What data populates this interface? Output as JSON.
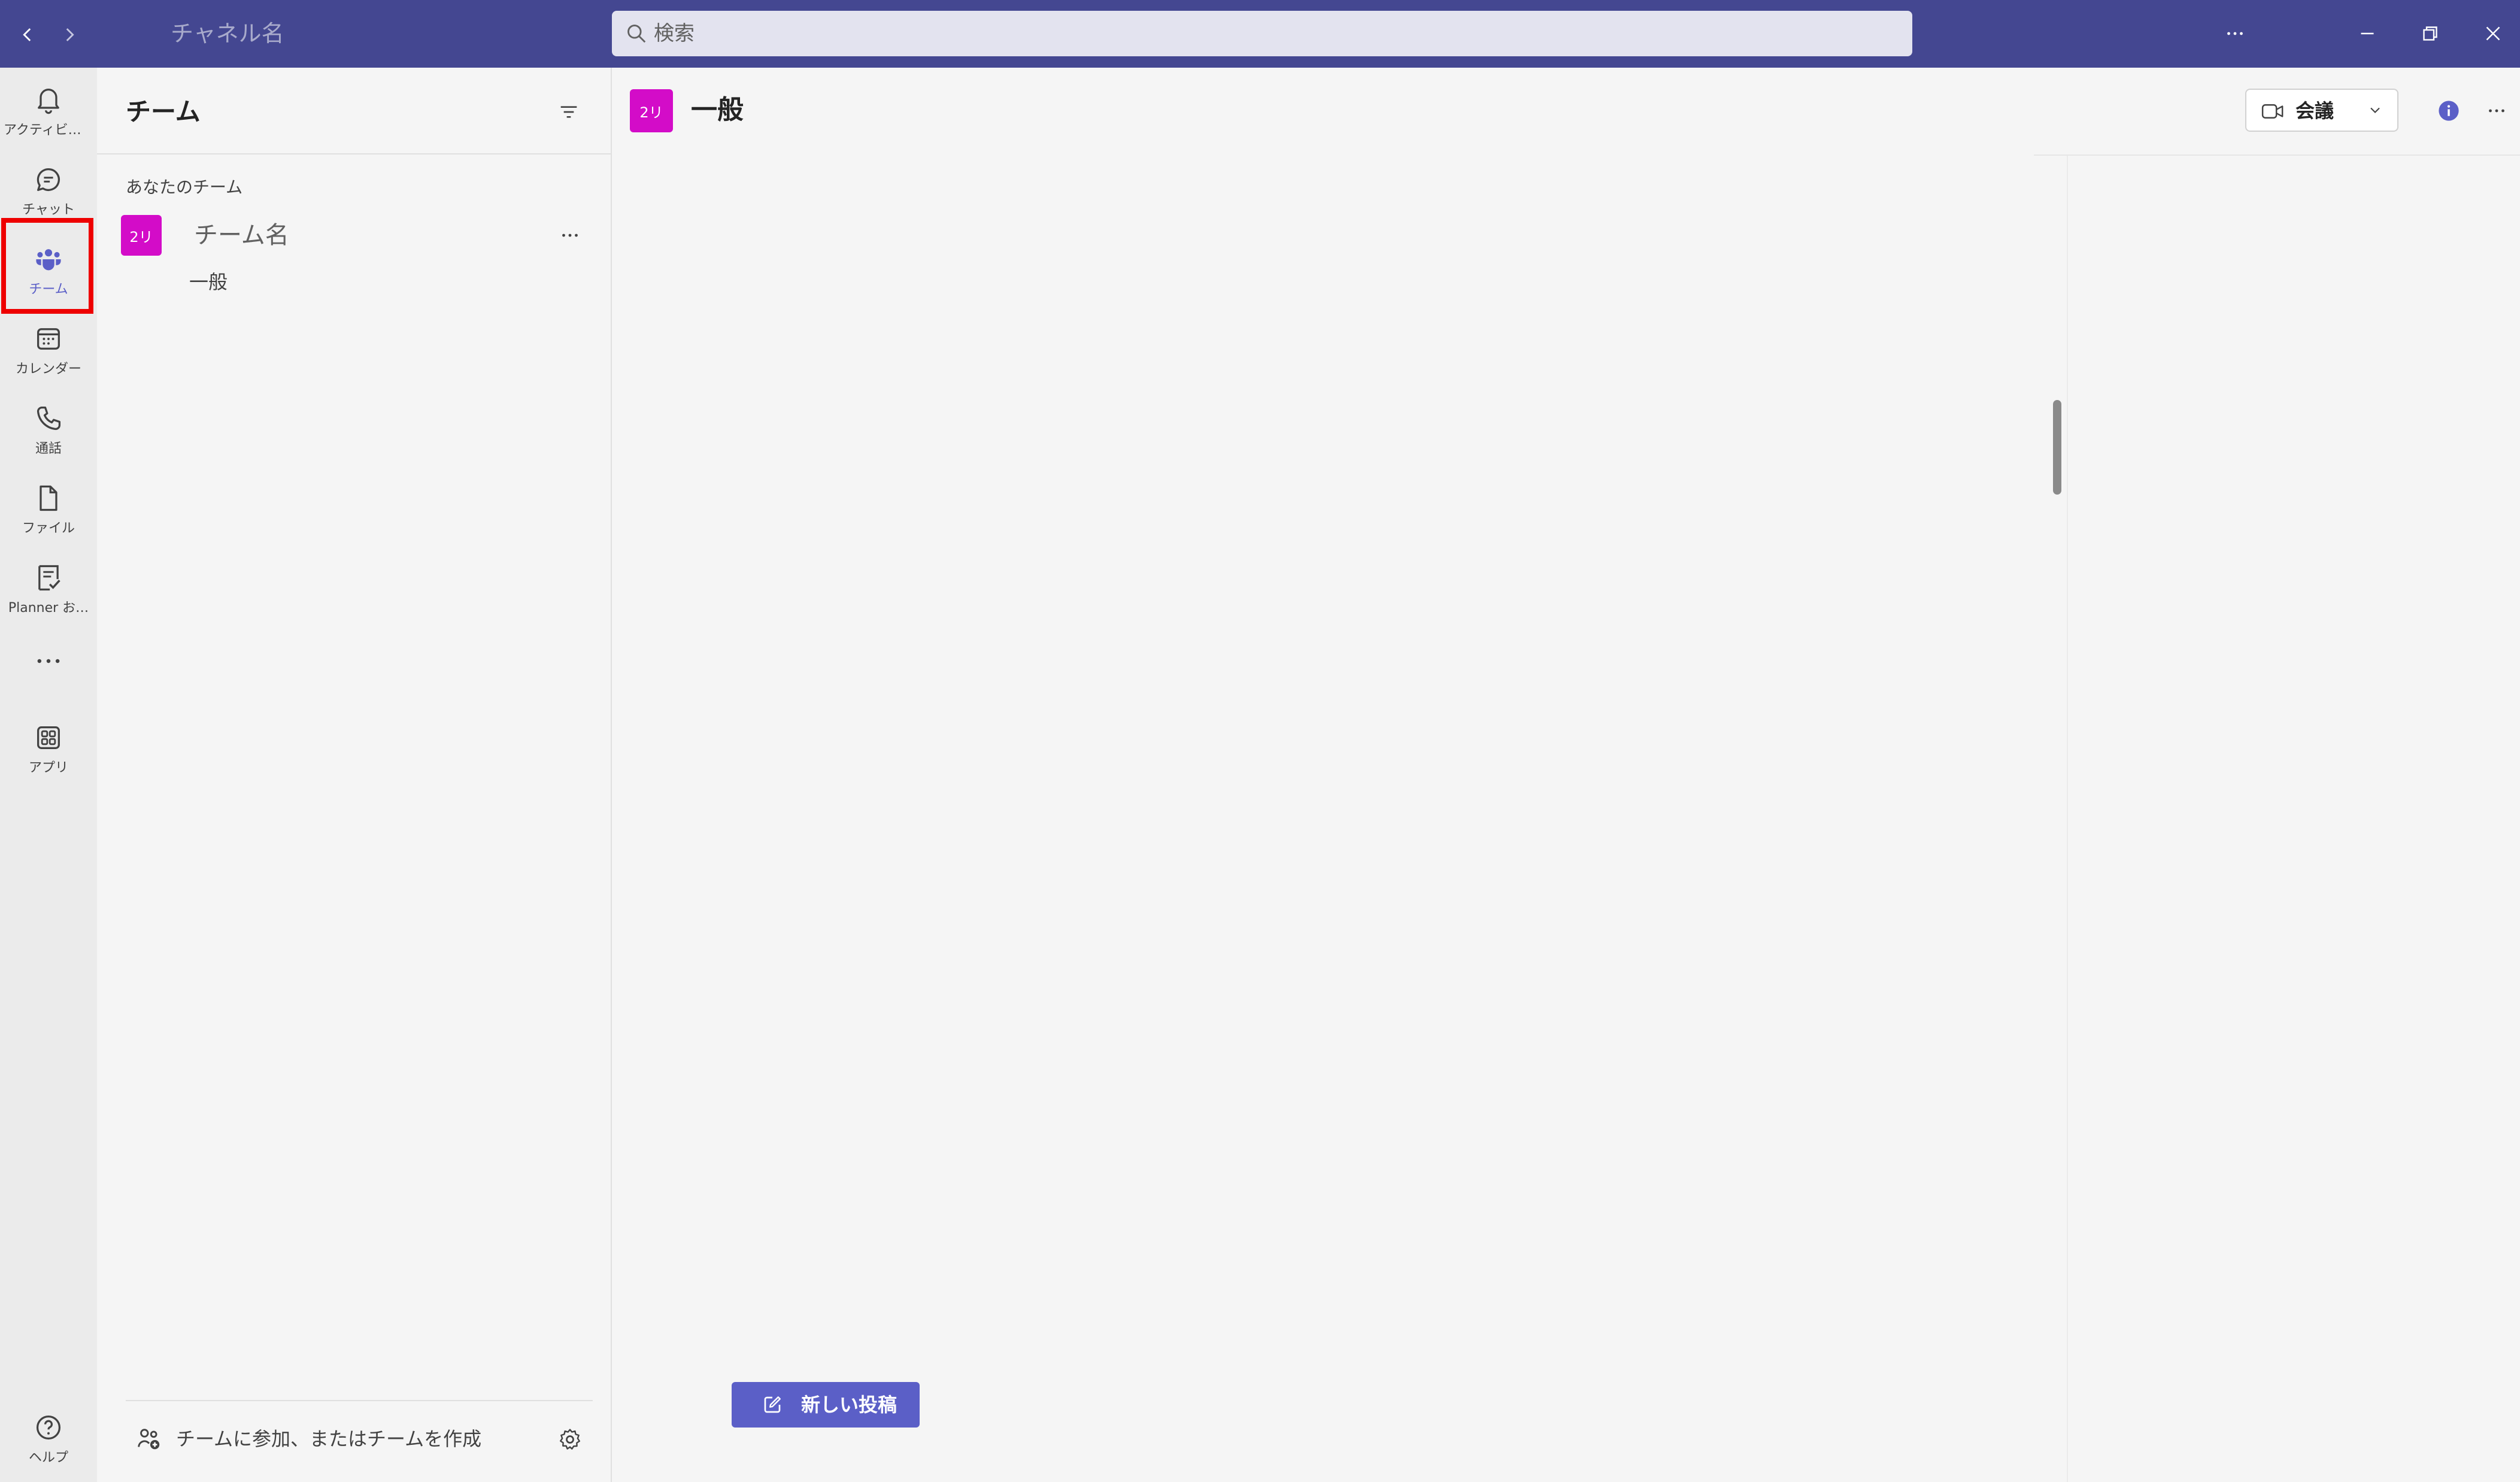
{
  "titlebar": {
    "title": "チャネル名",
    "search_placeholder": "検索",
    "back_icon": "chevron-left-icon",
    "forward_icon": "chevron-right-icon"
  },
  "rail": {
    "items": [
      {
        "label": "アクティビティ",
        "icon": "bell-icon"
      },
      {
        "label": "チャット",
        "icon": "chat-icon"
      },
      {
        "label": "チーム",
        "icon": "teams-icon"
      },
      {
        "label": "カレンダー",
        "icon": "calendar-icon"
      },
      {
        "label": "通話",
        "icon": "phone-icon"
      },
      {
        "label": "ファイル",
        "icon": "file-icon"
      },
      {
        "label": "Planner お…",
        "icon": "planner-icon"
      },
      {
        "label": "アプリ",
        "icon": "apps-icon"
      },
      {
        "label": "ヘルプ",
        "icon": "help-icon"
      }
    ],
    "active_item": "チーム"
  },
  "pane": {
    "title": "チーム",
    "section_label": "あなたのチーム",
    "team": {
      "avatar_text": "2リ",
      "name": "チーム名"
    },
    "channel": {
      "name": "一般"
    },
    "footer_link": "チームに参加、またはチームを作成"
  },
  "main": {
    "channel_avatar_text": "2リ",
    "channel_title": "一般",
    "meet_label": "会議",
    "new_post_label": "新しい投稿"
  },
  "colors": {
    "titlebar": "#444791",
    "accent": "#5b5fc7",
    "team_avatar": "#d30cc8",
    "highlight_box": "#ee0000"
  }
}
